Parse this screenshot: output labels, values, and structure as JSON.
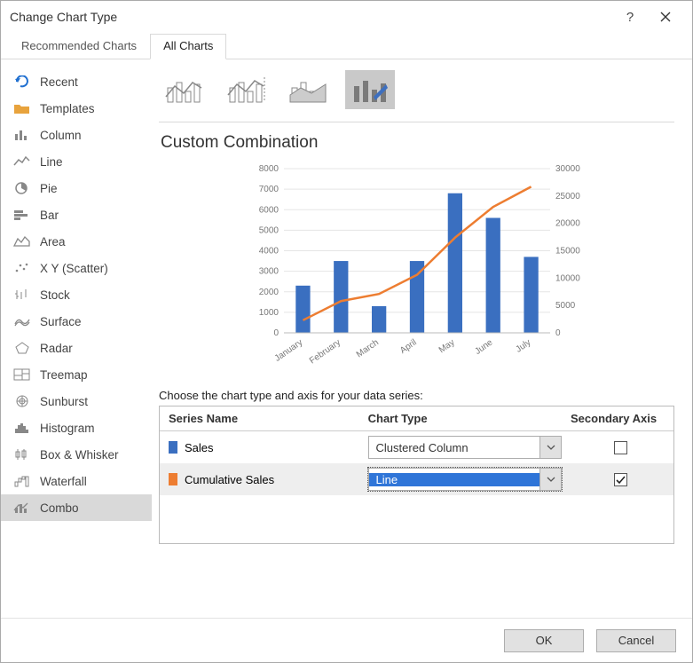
{
  "title": "Change Chart Type",
  "tabs": [
    {
      "label": "Recommended Charts",
      "active": false
    },
    {
      "label": "All Charts",
      "active": true
    }
  ],
  "sidebar": {
    "items": [
      {
        "label": "Recent",
        "icon": "undo-icon",
        "color": "#1f6fd0"
      },
      {
        "label": "Templates",
        "icon": "folder-icon",
        "color": "#e8a33d"
      },
      {
        "label": "Column",
        "icon": "column-icon",
        "color": "#888"
      },
      {
        "label": "Line",
        "icon": "line-icon",
        "color": "#888"
      },
      {
        "label": "Pie",
        "icon": "pie-icon",
        "color": "#888"
      },
      {
        "label": "Bar",
        "icon": "bar-icon",
        "color": "#888"
      },
      {
        "label": "Area",
        "icon": "area-icon",
        "color": "#888"
      },
      {
        "label": "X Y (Scatter)",
        "icon": "scatter-icon",
        "color": "#888"
      },
      {
        "label": "Stock",
        "icon": "stock-icon",
        "color": "#888"
      },
      {
        "label": "Surface",
        "icon": "surface-icon",
        "color": "#888"
      },
      {
        "label": "Radar",
        "icon": "radar-icon",
        "color": "#888"
      },
      {
        "label": "Treemap",
        "icon": "treemap-icon",
        "color": "#888"
      },
      {
        "label": "Sunburst",
        "icon": "sunburst-icon",
        "color": "#888"
      },
      {
        "label": "Histogram",
        "icon": "histogram-icon",
        "color": "#888"
      },
      {
        "label": "Box & Whisker",
        "icon": "boxwhisker-icon",
        "color": "#888"
      },
      {
        "label": "Waterfall",
        "icon": "waterfall-icon",
        "color": "#888"
      },
      {
        "label": "Combo",
        "icon": "combo-icon",
        "color": "#888",
        "selected": true
      }
    ]
  },
  "subtypes": {
    "selected_index": 3,
    "count": 4
  },
  "chart_title": "Custom Combination",
  "series_instruction": "Choose the chart type and axis for your data series:",
  "series_headers": {
    "name": "Series Name",
    "type": "Chart Type",
    "axis": "Secondary Axis"
  },
  "series": [
    {
      "name": "Sales",
      "swatch": "#3a6fc0",
      "chart_type": "Clustered Column",
      "secondary": false,
      "highlight": false
    },
    {
      "name": "Cumulative Sales",
      "swatch": "#ed7d31",
      "chart_type": "Line",
      "secondary": true,
      "highlight": true
    }
  ],
  "buttons": {
    "ok": "OK",
    "cancel": "Cancel"
  },
  "chart_data": {
    "type": "combo",
    "categories": [
      "January",
      "February",
      "March",
      "April",
      "May",
      "June",
      "July"
    ],
    "series": [
      {
        "name": "Sales",
        "type": "bar",
        "axis": "primary",
        "color": "#3a6fc0",
        "values": [
          2300,
          3500,
          1300,
          3500,
          6800,
          5600,
          3700
        ]
      },
      {
        "name": "Cumulative Sales",
        "type": "line",
        "axis": "secondary",
        "color": "#ed7d31",
        "values": [
          2300,
          5800,
          7100,
          10600,
          17400,
          23000,
          26700
        ]
      }
    ],
    "primary_axis": {
      "min": 0,
      "max": 8000,
      "ticks": [
        0,
        1000,
        2000,
        3000,
        4000,
        5000,
        6000,
        7000,
        8000
      ]
    },
    "secondary_axis": {
      "min": 0,
      "max": 30000,
      "ticks": [
        0,
        5000,
        10000,
        15000,
        20000,
        25000,
        30000
      ]
    }
  }
}
